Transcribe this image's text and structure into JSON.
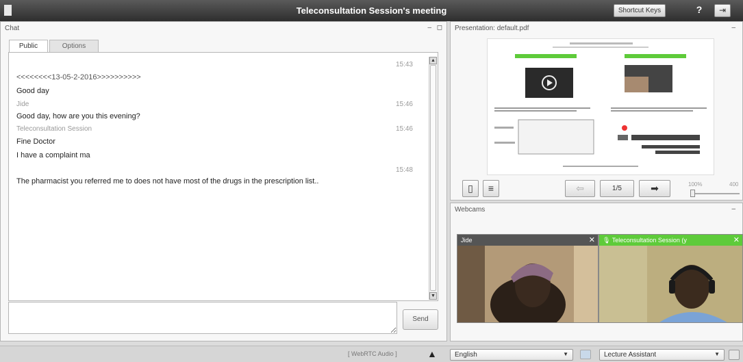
{
  "header": {
    "title": "Teleconsultation Session's meeting",
    "shortcut_label": "Shortcut Keys",
    "help_label": "?",
    "logout_icon": "logout-icon"
  },
  "chat": {
    "title": "Chat",
    "tabs": [
      {
        "label": "Public",
        "active": true
      },
      {
        "label": "Options",
        "active": false
      }
    ],
    "messages": {
      "divider": "<<<<<<<<13-05-2-2016>>>>>>>>>>",
      "time1": "15:43",
      "m1": "Good day",
      "sender2": "Jide",
      "time2": "15:46",
      "m2": "Good day, how are you this evening?",
      "sender3": "Teleconsultation Session",
      "time3": "15:46",
      "m3": "Fine Doctor",
      "m4": "I have a complaint ma",
      "time4": "15:48",
      "m5": "The pharmacist you referred me to does not have most of the drugs in the prescription list.."
    },
    "send_label": "Send",
    "input_value": ""
  },
  "presentation": {
    "title": "Presentation: default.pdf",
    "page_indicator": "1/5",
    "zoom_min": "100%",
    "zoom_max": "400"
  },
  "webcams": {
    "title": "Webcams",
    "cam1_name": "Jide",
    "cam2_name": "Teleconsultation Session (y"
  },
  "statusbar": {
    "audio_label": "[ WebRTC Audio ]",
    "language": "English",
    "layout": "Lecture Assistant"
  },
  "colors": {
    "header_bg": "#3c3c3c",
    "cam2_header": "#5ecb3a",
    "cam1_header": "#555555"
  }
}
